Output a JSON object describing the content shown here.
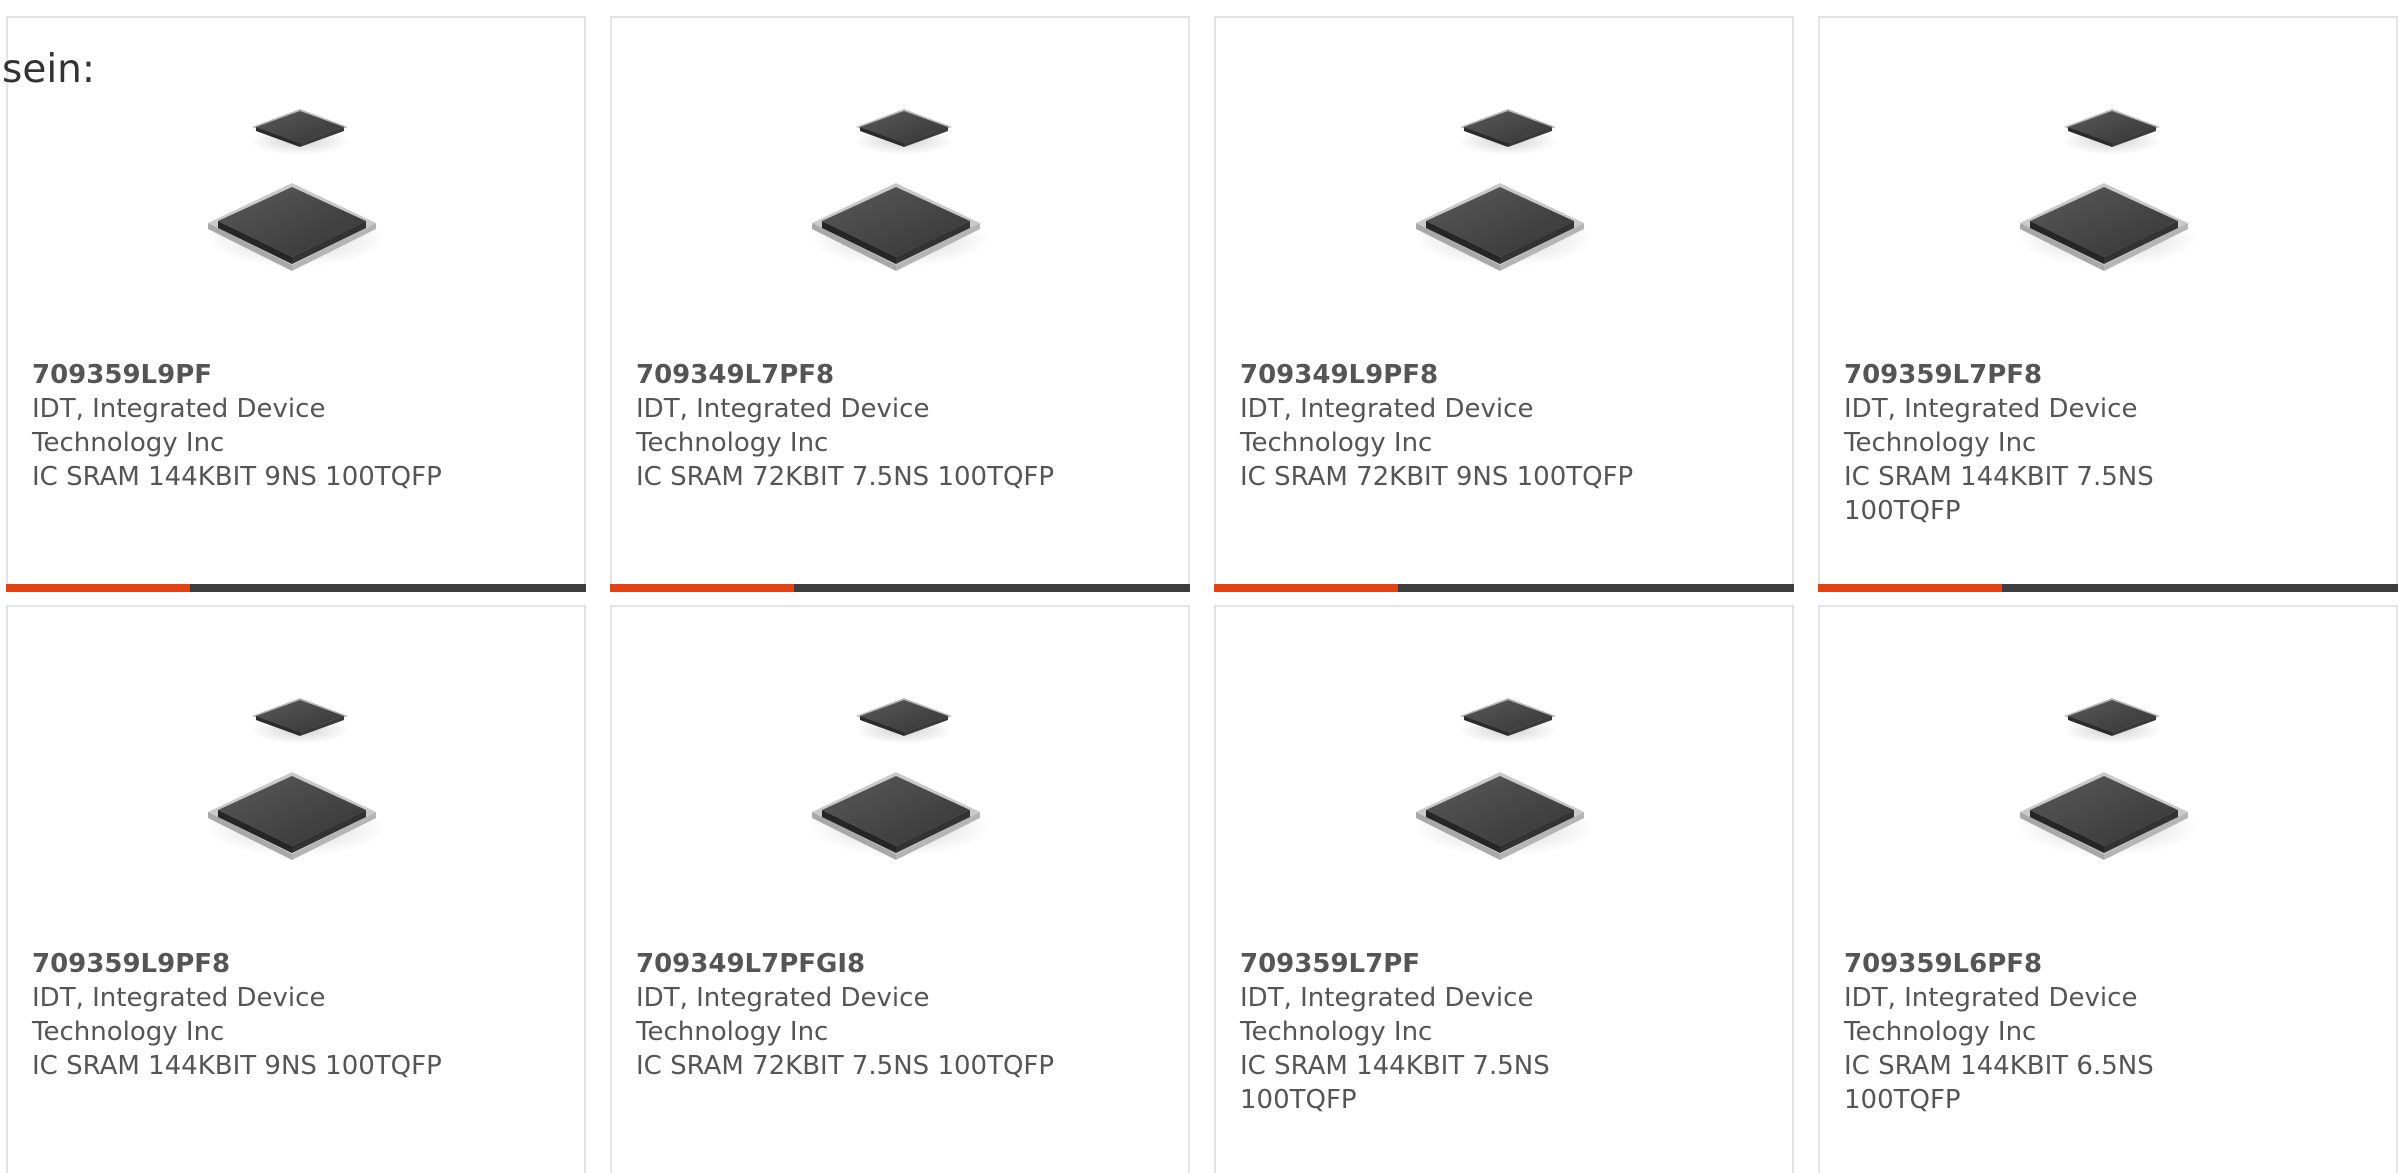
{
  "page": {
    "lead_text": "sein:"
  },
  "colors": {
    "accent": "#e34312",
    "bar": "#3d3d3d",
    "chip_body": "#454545",
    "text": "#555555"
  },
  "products": [
    {
      "part": "709359L9PF",
      "manufacturer": "IDT, Integrated Device Technology Inc",
      "description": "IC SRAM 144KBIT 9NS 100TQFP",
      "image_icon": "qfp-chip-image"
    },
    {
      "part": "709349L7PF8",
      "manufacturer": "IDT, Integrated Device Technology Inc",
      "description": "IC SRAM 72KBIT 7.5NS 100TQFP",
      "image_icon": "qfp-chip-image"
    },
    {
      "part": "709349L9PF8",
      "manufacturer": "IDT, Integrated Device Technology Inc",
      "description": "IC SRAM 72KBIT 9NS 100TQFP",
      "image_icon": "qfp-chip-image"
    },
    {
      "part": "709359L7PF8",
      "manufacturer": "IDT, Integrated Device Technology Inc",
      "description": "IC SRAM 144KBIT 7.5NS 100TQFP",
      "image_icon": "qfp-chip-image"
    },
    {
      "part": "709359L9PF8",
      "manufacturer": "IDT, Integrated Device Technology Inc",
      "description": "IC SRAM 144KBIT 9NS 100TQFP",
      "image_icon": "qfp-chip-image"
    },
    {
      "part": "709349L7PFGI8",
      "manufacturer": "IDT, Integrated Device Technology Inc",
      "description": "IC SRAM 72KBIT 7.5NS 100TQFP",
      "image_icon": "qfp-chip-image"
    },
    {
      "part": "709359L7PF",
      "manufacturer": "IDT, Integrated Device Technology Inc",
      "description": "IC SRAM 144KBIT 7.5NS 100TQFP",
      "image_icon": "qfp-chip-image"
    },
    {
      "part": "709359L6PF8",
      "manufacturer": "IDT, Integrated Device Technology Inc",
      "description": "IC SRAM 144KBIT 6.5NS 100TQFP",
      "image_icon": "qfp-chip-image"
    }
  ]
}
